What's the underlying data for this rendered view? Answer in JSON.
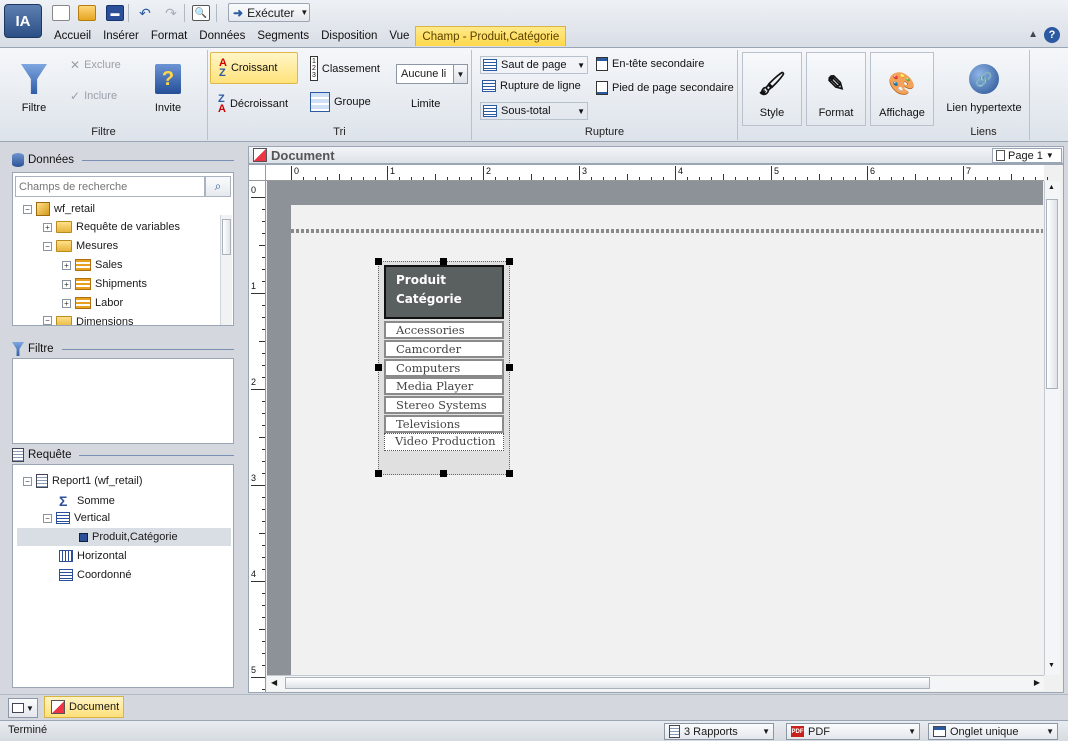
{
  "app": {
    "logo": "IA"
  },
  "quick_access": {
    "run_label": "Exécuter"
  },
  "tabs": [
    {
      "label": "Accueil"
    },
    {
      "label": "Insérer"
    },
    {
      "label": "Format"
    },
    {
      "label": "Données"
    },
    {
      "label": "Segments"
    },
    {
      "label": "Disposition"
    },
    {
      "label": "Vue"
    },
    {
      "label": "Champ - Produit,Catégorie"
    }
  ],
  "ribbon": {
    "filtre_group": {
      "label": "Filtre",
      "filtre": "Filtre",
      "exclure": "Exclure",
      "inclure": "Inclure",
      "invite": "Invite"
    },
    "tri_group": {
      "label": "Tri",
      "croissant": "Croissant",
      "decroissant": "Décroissant",
      "classement": "Classement",
      "groupe": "Groupe",
      "limit_value": "Aucune li",
      "limite": "Limite"
    },
    "rupture_group": {
      "label": "Rupture",
      "saut_de_page": "Saut de page",
      "rupture_de_ligne": "Rupture de ligne",
      "sous_total": "Sous-total",
      "entete_secondaire": "En-tête secondaire",
      "pied_secondaire": "Pied de page secondaire"
    },
    "style": "Style",
    "format": "Format",
    "affichage": "Affichage",
    "liens_group": {
      "label": "Liens",
      "lien": "Lien hypertexte"
    }
  },
  "data_panel": {
    "title": "Données",
    "search_placeholder": "Champs de recherche",
    "tree": [
      {
        "label": "wf_retail"
      },
      {
        "label": "Requête de variables"
      },
      {
        "label": "Mesures"
      },
      {
        "label": "Sales"
      },
      {
        "label": "Shipments"
      },
      {
        "label": "Labor"
      },
      {
        "label": "Dimensions"
      }
    ]
  },
  "filter_panel": {
    "title": "Filtre"
  },
  "query_panel": {
    "title": "Requête",
    "tree": [
      {
        "label": "Report1 (wf_retail)"
      },
      {
        "label": "Somme"
      },
      {
        "label": "Vertical"
      },
      {
        "label": "Produit,Catégorie"
      },
      {
        "label": "Horizontal"
      },
      {
        "label": "Coordonné"
      }
    ]
  },
  "document": {
    "title": "Document",
    "page_label": "Page 1",
    "ruler_h": [
      "0",
      "1",
      "2",
      "3",
      "4",
      "5",
      "6",
      "7"
    ],
    "ruler_v": [
      "0",
      "1",
      "2",
      "3",
      "4",
      "5"
    ],
    "report": {
      "header_line1": "Produit",
      "header_line2": "Catégorie",
      "rows": [
        "Accessories",
        "Camcorder",
        "Computers",
        "Media Player",
        "Stereo Systems",
        "Televisions",
        "Video Production"
      ]
    }
  },
  "bottom_tabs": {
    "document_tab": "Document"
  },
  "status": {
    "text": "Terminé",
    "reports": "3 Rapports",
    "format": "PDF",
    "output": "Onglet unique"
  }
}
